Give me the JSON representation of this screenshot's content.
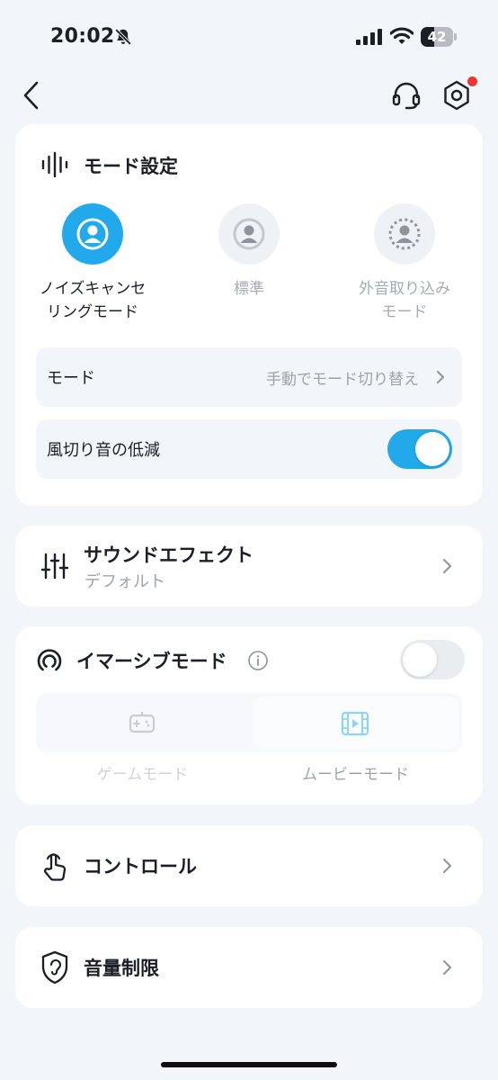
{
  "status_bar": {
    "time": "20:02",
    "battery": 42
  },
  "mode_settings": {
    "title": "モード設定",
    "options": [
      {
        "label": "ノイズキャンセリングモード",
        "line1": "ノイズキャンセ",
        "line2": "リングモード",
        "active": true,
        "icon": "person-ring-icon"
      },
      {
        "label": "標準",
        "line1": "標準",
        "line2": "",
        "active": false,
        "icon": "person-circle-icon"
      },
      {
        "label": "外音取り込みモード",
        "line1": "外音取り込み",
        "line2": "モード",
        "active": false,
        "icon": "person-dotted-icon"
      }
    ],
    "mode_row": {
      "label": "モード",
      "value": "手動でモード切り替え"
    },
    "wind_row": {
      "label": "風切り音の低減",
      "enabled": true
    }
  },
  "sound_effect": {
    "title": "サウンドエフェクト",
    "value": "デフォルト"
  },
  "immersive": {
    "title": "イマーシブモード",
    "enabled": false,
    "options": [
      {
        "label": "ゲームモード",
        "icon": "gamepad-icon"
      },
      {
        "label": "ムービーモード",
        "icon": "film-icon"
      }
    ]
  },
  "control": {
    "title": "コントロール"
  },
  "volume_limit": {
    "title": "音量制限"
  },
  "colors": {
    "accent": "#22a9ec",
    "background": "#f2f5f9",
    "badge": "#f0352f",
    "muted_text": "#9ea3aa"
  }
}
